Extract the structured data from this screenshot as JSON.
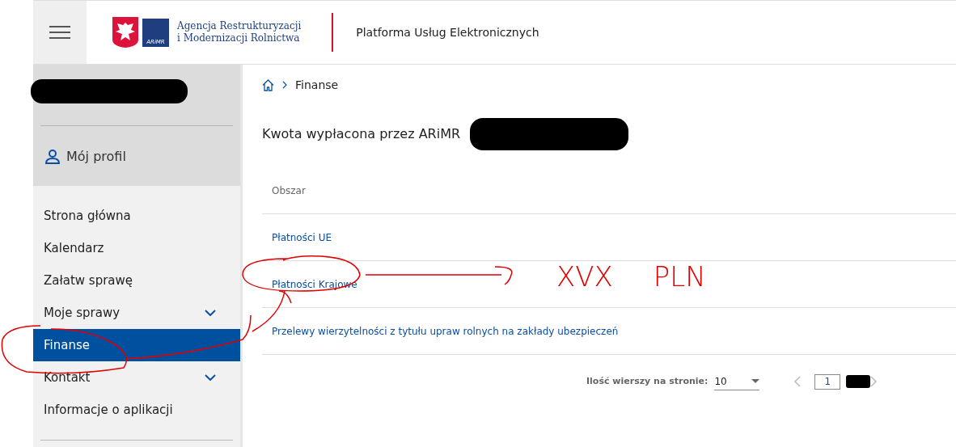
{
  "header": {
    "logo": {
      "emblem_text": "ARiMR",
      "lines": [
        "Agencja Restrukturyzacji",
        "i Modernizacji Rolnictwa"
      ]
    },
    "title": "Platforma Usług Elektronicznych"
  },
  "sidebar": {
    "profile": "Mój profil",
    "items": [
      {
        "label": "Strona główna",
        "selected": false,
        "expandable": false
      },
      {
        "label": "Kalendarz",
        "selected": false,
        "expandable": false
      },
      {
        "label": "Załatw sprawę",
        "selected": false,
        "expandable": false
      },
      {
        "label": "Moje sprawy",
        "selected": false,
        "expandable": true
      },
      {
        "label": "Finanse",
        "selected": true,
        "expandable": false
      },
      {
        "label": "Kontakt",
        "selected": false,
        "expandable": true
      },
      {
        "label": "Informacje o aplikacji",
        "selected": false,
        "expandable": false
      }
    ]
  },
  "breadcrumb": [
    "Finanse"
  ],
  "heading": "Kwota wypłacona przez ARiMR",
  "table": {
    "columns": [
      "Obszar"
    ],
    "rows": [
      [
        "Płatności UE"
      ],
      [
        "Płatności Krajowe"
      ],
      [
        "Przelewy wierzytelności z tytułu upraw rolnych na zakłady ubezpieczeń"
      ]
    ]
  },
  "pagination": {
    "label": "Ilość wierszy na stronie:",
    "rows_per_page": "10",
    "page": "1"
  },
  "annotations": [
    "XVX",
    "PLN"
  ]
}
